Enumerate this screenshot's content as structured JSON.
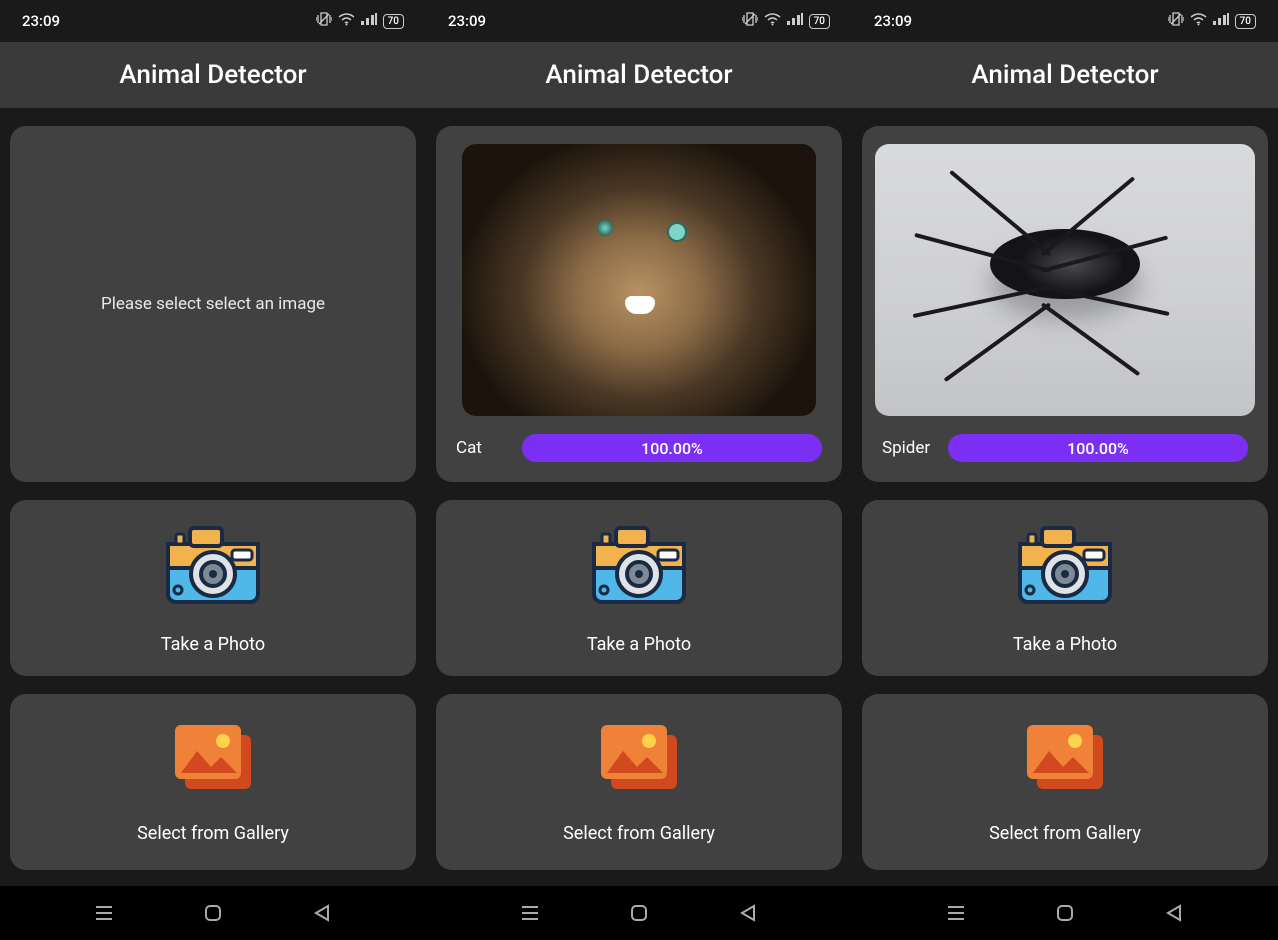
{
  "status": {
    "time": "23:09",
    "battery": "70"
  },
  "app": {
    "title": "Animal Detector"
  },
  "actions": {
    "take_photo": "Take a Photo",
    "select_gallery": "Select from Gallery"
  },
  "screens": [
    {
      "has_image": false,
      "placeholder": "Please select select an image"
    },
    {
      "has_image": true,
      "image_kind": "cat",
      "result_label": "Cat",
      "confidence": "100.00%"
    },
    {
      "has_image": true,
      "image_kind": "spider",
      "result_label": "Spider",
      "confidence": "100.00%"
    }
  ]
}
